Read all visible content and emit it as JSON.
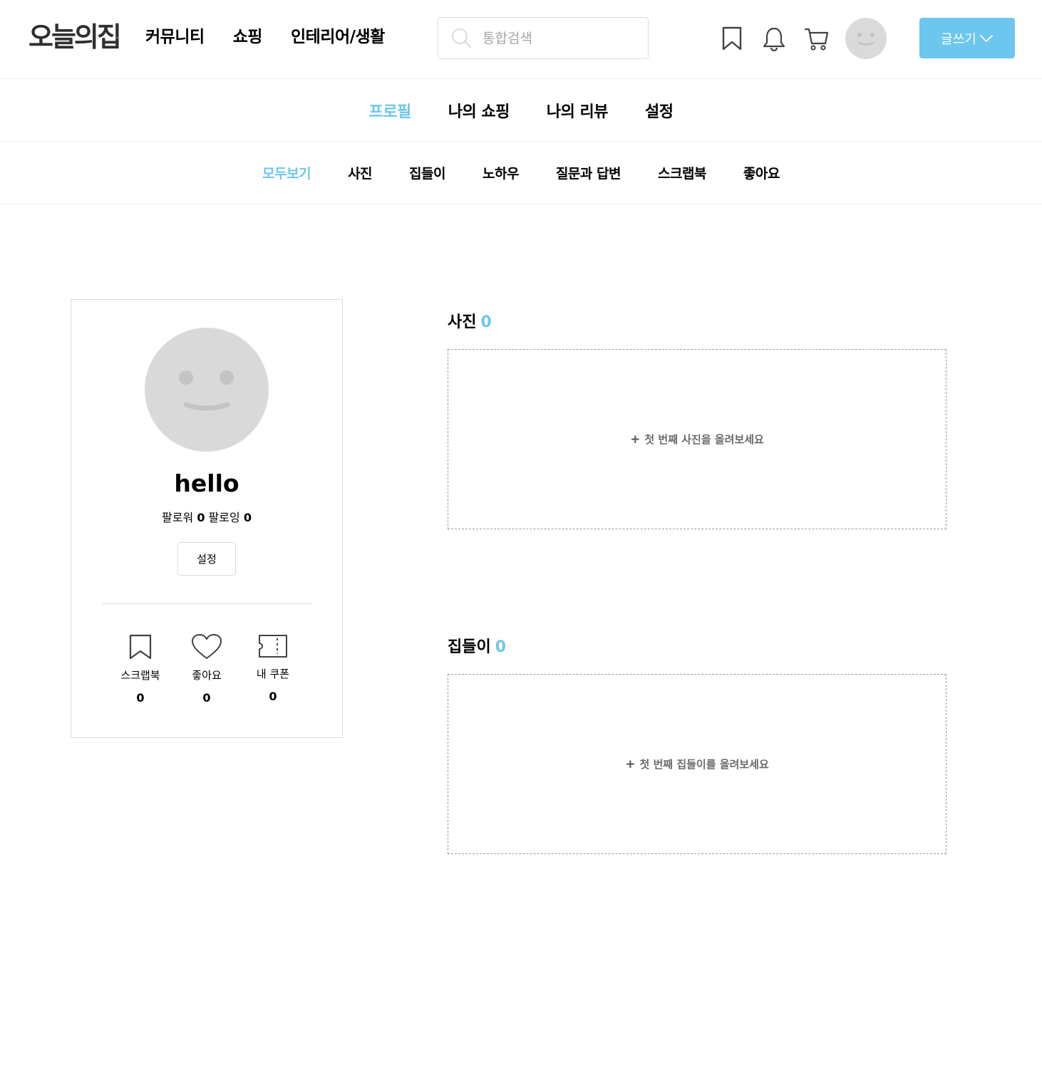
{
  "header": {
    "logo": "오늘의집",
    "nav": [
      "커뮤니티",
      "쇼핑",
      "인테리어/생활"
    ],
    "search": {
      "placeholder": "통합검색",
      "value": ""
    },
    "icons": [
      "bookmark-icon",
      "bell-icon",
      "cart-icon"
    ],
    "write_button": "글쓰기"
  },
  "tabs": {
    "items": [
      "프로필",
      "나의 쇼핑",
      "나의 리뷰",
      "설정"
    ],
    "active": "프로필"
  },
  "subtabs": {
    "items": [
      "모두보기",
      "사진",
      "집들이",
      "노하우",
      "질문과 답변",
      "스크랩북",
      "좋아요"
    ],
    "active": "모두보기"
  },
  "profile": {
    "username": "hello",
    "followers_label": "팔로워",
    "followers": "0",
    "following_label": "팔로잉",
    "following": "0",
    "settings_button": "설정",
    "stats": [
      {
        "label": "스크랩북",
        "value": "0",
        "icon": "bookmark-icon"
      },
      {
        "label": "좋아요",
        "value": "0",
        "icon": "heart-icon"
      },
      {
        "label": "내 쿠폰",
        "value": "0",
        "icon": "coupon-icon"
      }
    ]
  },
  "sections": {
    "photos": {
      "title": "사진",
      "count": "0",
      "empty_text": "첫 번째 사진을 올려보세요"
    },
    "housewarming": {
      "title": "집들이",
      "count": "0",
      "empty_text": "첫 번째 집들이를 올려보세요"
    }
  },
  "colors": {
    "accent": "#6dc6ed",
    "border": "#dbdbdb",
    "avatar": "#d9d9d9"
  }
}
